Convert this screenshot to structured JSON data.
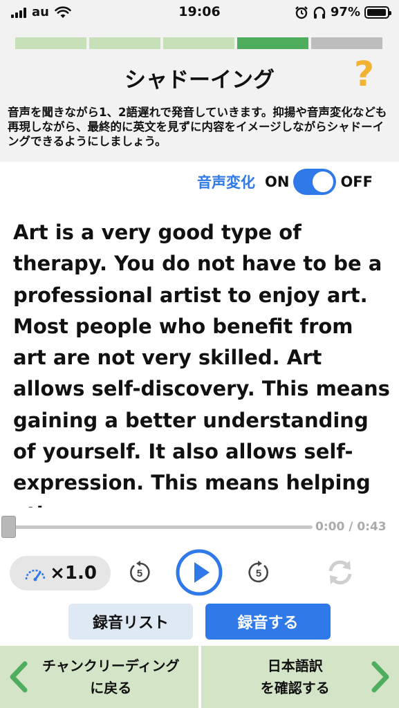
{
  "status_bar": {
    "carrier": "au",
    "time": "19:06",
    "battery": "97%",
    "battery_level": 0.97,
    "icons": [
      "signal-icon",
      "wifi-icon",
      "alarm-icon",
      "headphones-icon",
      "battery-icon"
    ]
  },
  "header": {
    "progress_segments": [
      "done",
      "done",
      "done",
      "current",
      "todo"
    ],
    "progress_colors": {
      "done": "#c8e0b8",
      "current": "#4fae5d",
      "todo": "#bdbdbd"
    },
    "title": "シャドーイング",
    "help_icon": "?",
    "description": "音声を聞きながら1、2語遅れで発音していきます。抑揚や音声変化なども再現しながら、最終的に英文を見ずに内容をイメージしながらシャドーイングできるようにしましょう。"
  },
  "voice_change": {
    "label": "音声変化",
    "on_label": "ON",
    "off_label": "OFF",
    "state": "ON"
  },
  "passage": {
    "text": "Art is a very good type of therapy. You do not have to be a professional artist to enjoy art. Most people who benefit from art are not very skilled. Art allows self-discovery. This means gaining a better understanding of yourself. It also allows self-expression. This means helping others"
  },
  "player": {
    "time": "0:00 / 0:43",
    "position_fraction": 0,
    "speed": "×1.0",
    "rewind_seconds": "5",
    "forward_seconds": "5"
  },
  "recording": {
    "list_label": "録音リスト",
    "record_label": "録音する"
  },
  "bottom_nav": {
    "prev_line1": "チャンクリーディング",
    "prev_line2": "に戻る",
    "next_line1": "日本語訳",
    "next_line2": "を確認する"
  },
  "colors": {
    "accent_blue": "#2f79e8",
    "help_yellow": "#f2b233",
    "nav_green": "#d3e4c7",
    "chevron_green": "#4fae5d"
  }
}
